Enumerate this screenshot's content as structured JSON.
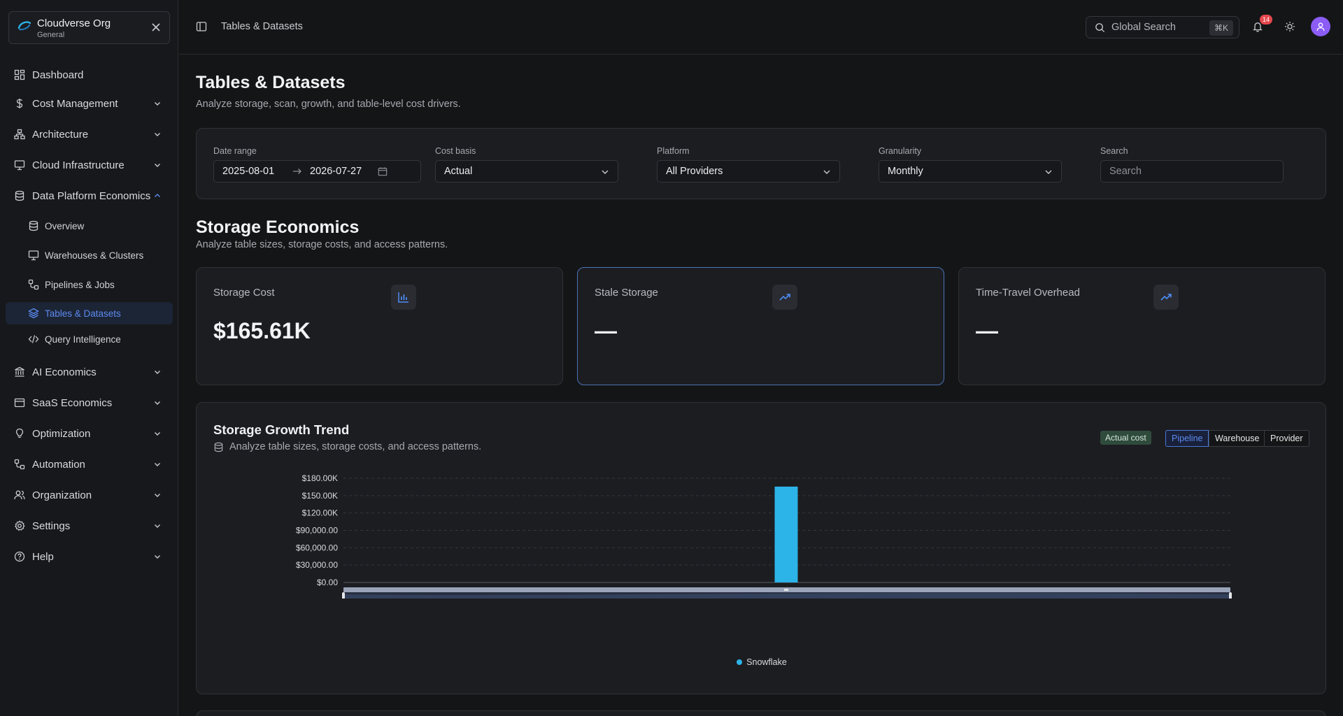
{
  "org": {
    "name": "Cloudverse Org",
    "workspace": "General"
  },
  "sidebar": {
    "items": [
      {
        "label": "Dashboard",
        "icon": "dashboard-icon"
      },
      {
        "label": "Cost Management",
        "icon": "dollar-icon"
      },
      {
        "label": "Architecture",
        "icon": "architecture-icon"
      },
      {
        "label": "Cloud Infrastructure",
        "icon": "monitor-icon"
      },
      {
        "label": "Data Platform Economics",
        "icon": "database-icon",
        "expanded": true
      },
      {
        "label": "AI Economics",
        "icon": "bank-icon"
      },
      {
        "label": "SaaS Economics",
        "icon": "window-icon"
      },
      {
        "label": "Optimization",
        "icon": "lightbulb-icon"
      },
      {
        "label": "Automation",
        "icon": "workflow-icon"
      },
      {
        "label": "Organization",
        "icon": "users-icon"
      },
      {
        "label": "Settings",
        "icon": "gear-icon"
      },
      {
        "label": "Help",
        "icon": "help-icon"
      }
    ],
    "subitems": [
      {
        "label": "Overview",
        "icon": "database-icon"
      },
      {
        "label": "Warehouses & Clusters",
        "icon": "monitor-icon"
      },
      {
        "label": "Pipelines & Jobs",
        "icon": "workflow-icon"
      },
      {
        "label": "Tables & Datasets",
        "icon": "layers-icon",
        "active": true
      },
      {
        "label": "Query Intelligence",
        "icon": "code-icon"
      }
    ]
  },
  "topbar": {
    "breadcrumb": "Tables & Datasets",
    "search_label": "Global Search",
    "search_shortcut": "⌘K",
    "notifications": "14"
  },
  "page": {
    "title": "Tables & Datasets",
    "subtitle": "Analyze storage, scan, growth, and table-level cost drivers."
  },
  "filters": {
    "date_range": {
      "label": "Date range",
      "start": "2025-08-01",
      "end": "2026-07-27"
    },
    "cost_basis": {
      "label": "Cost basis",
      "value": "Actual"
    },
    "platform": {
      "label": "Platform",
      "value": "All Providers"
    },
    "granularity": {
      "label": "Granularity",
      "value": "Monthly"
    },
    "search": {
      "label": "Search",
      "placeholder": "Search"
    }
  },
  "storage": {
    "title": "Storage Economics",
    "subtitle": "Analyze table sizes, storage costs, and access patterns.",
    "kpis": [
      {
        "label": "Storage Cost",
        "value": "$165.61K",
        "icon": "bar-chart-icon"
      },
      {
        "label": "Stale Storage",
        "value": "—",
        "icon": "trend-up-icon"
      },
      {
        "label": "Time-Travel Overhead",
        "value": "—",
        "icon": "trend-up-icon"
      }
    ]
  },
  "growth": {
    "title": "Storage Growth Trend",
    "subtitle": "Analyze table sizes, storage costs, and access patterns.",
    "badge": "Actual cost",
    "tabs": [
      "Pipeline",
      "Warehouse",
      "Provider"
    ],
    "active_tab": "Pipeline"
  },
  "chart_data": {
    "type": "bar",
    "y_ticks": [
      "$180.00K",
      "$150.00K",
      "$120.00K",
      "$90,000.00",
      "$60,000.00",
      "$30,000.00",
      "$0.00"
    ],
    "ylim": [
      0,
      180000
    ],
    "series": [
      {
        "name": "Snowflake",
        "values": [
          165610
        ],
        "color": "#2cb4e8"
      }
    ],
    "legend_position": "bottom",
    "grid": true
  }
}
